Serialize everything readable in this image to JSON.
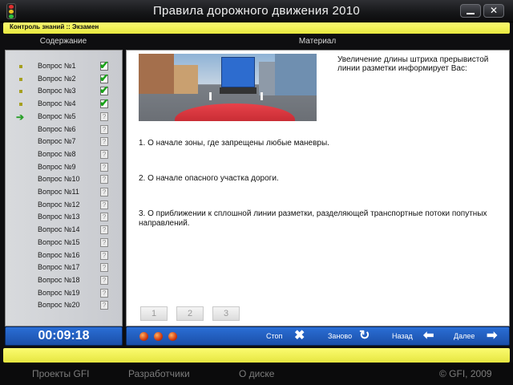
{
  "window": {
    "title": "Правила дорожного движения 2010",
    "minimize_icon": "minimize-icon",
    "close_label": "✕"
  },
  "breadcrumb": "Контроль знаний :: Экзамен",
  "headers": {
    "left": "Содержание",
    "right": "Материал"
  },
  "questions": [
    {
      "label": "Вопрос №1",
      "status": "answered"
    },
    {
      "label": "Вопрос №2",
      "status": "answered"
    },
    {
      "label": "Вопрос №3",
      "status": "answered"
    },
    {
      "label": "Вопрос №4",
      "status": "answered"
    },
    {
      "label": "Вопрос №5",
      "status": "current"
    },
    {
      "label": "Вопрос №6",
      "status": "pending"
    },
    {
      "label": "Вопрос №7",
      "status": "pending"
    },
    {
      "label": "Вопрос №8",
      "status": "pending"
    },
    {
      "label": "Вопрос №9",
      "status": "pending"
    },
    {
      "label": "Вопрос №10",
      "status": "pending"
    },
    {
      "label": "Вопрос №11",
      "status": "pending"
    },
    {
      "label": "Вопрос №12",
      "status": "pending"
    },
    {
      "label": "Вопрос №13",
      "status": "pending"
    },
    {
      "label": "Вопрос №14",
      "status": "pending"
    },
    {
      "label": "Вопрос №15",
      "status": "pending"
    },
    {
      "label": "Вопрос №16",
      "status": "pending"
    },
    {
      "label": "Вопрос №17",
      "status": "pending"
    },
    {
      "label": "Вопрос №18",
      "status": "pending"
    },
    {
      "label": "Вопрос №19",
      "status": "pending"
    },
    {
      "label": "Вопрос №20",
      "status": "pending"
    }
  ],
  "pending_mark": "?",
  "check_mark": "✔",
  "current_arrow": "➔",
  "content": {
    "question_text": "Увеличение длины штриха прерывистой линии разметки информирует Вас:",
    "answers": [
      "1. О начале зоны, где запрещены любые маневры.",
      "2. О начале опасного участка дороги.",
      "3. О приближении к сплошной линии разметки, разделяющей транспортные потоки попутных направлений."
    ],
    "answer_buttons": [
      "1",
      "2",
      "3"
    ]
  },
  "timer": "00:09:18",
  "controls": {
    "stop": "Стоп",
    "again": "Заново",
    "back": "Назад",
    "next": "Далее",
    "stop_icon": "✖",
    "again_icon": "↻",
    "back_icon": "⬅",
    "next_icon": "➡"
  },
  "footer": {
    "projects": "Проекты GFI",
    "developers": "Разработчики",
    "about": "О диске",
    "copyright": "© GFI, 2009"
  },
  "colors": {
    "accent_yellow": "#f2f256",
    "panel_blue": "#2a6ed6",
    "check_green": "#1aa21a"
  }
}
